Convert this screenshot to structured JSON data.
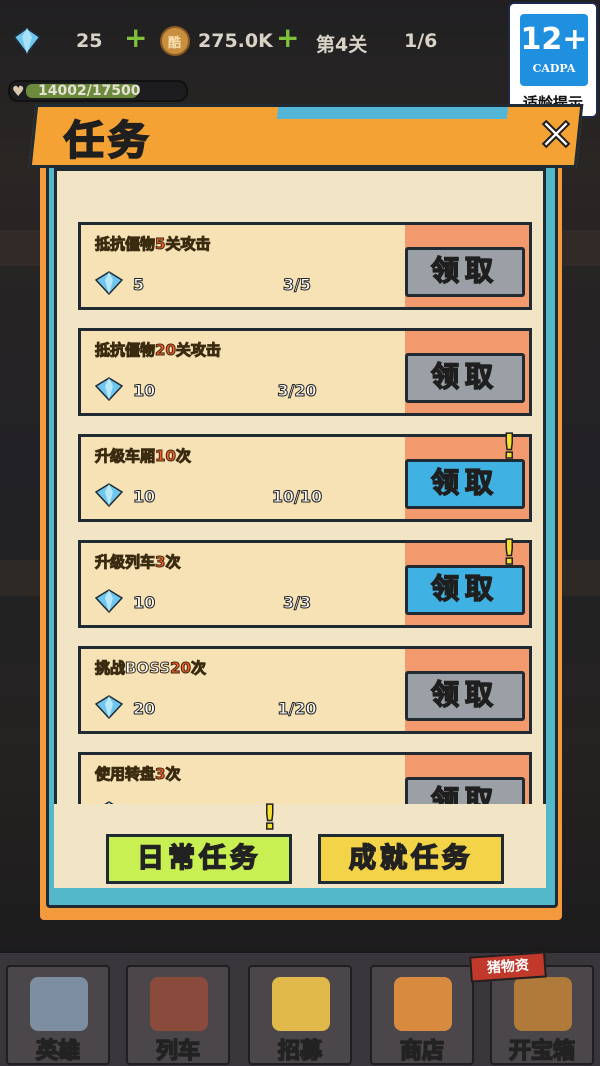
{
  "hud": {
    "gems": "25",
    "coins": "275.0K",
    "stage": "第4关",
    "wave": "1/6",
    "hp": "14002/17500",
    "hp_fraction": 0.8,
    "coin_glyph": "酷"
  },
  "rating": {
    "age": "12+",
    "brand": "CADPA",
    "tip": "适龄提示"
  },
  "dialog": {
    "title": "任务",
    "close": "✕"
  },
  "tasks": [
    {
      "label_pre": "抵抗僵物",
      "highlight": "5",
      "label_post": "关攻击",
      "reward": "5",
      "progress": "3/5",
      "claim": "领取",
      "claimable": false
    },
    {
      "label_pre": "抵抗僵物",
      "highlight": "20",
      "label_post": "关攻击",
      "reward": "10",
      "progress": "3/20",
      "claim": "领取",
      "claimable": false
    },
    {
      "label_pre": "升级车厢",
      "highlight": "10",
      "label_post": "次",
      "reward": "10",
      "progress": "10/10",
      "claim": "领取",
      "claimable": true
    },
    {
      "label_pre": "升级列车",
      "highlight": "3",
      "label_post": "次",
      "reward": "10",
      "progress": "3/3",
      "claim": "领取",
      "claimable": true
    },
    {
      "label_pre": "挑战BOSS",
      "highlight": "20",
      "label_post": "次",
      "reward": "20",
      "progress": "1/20",
      "claim": "领取",
      "claimable": false
    },
    {
      "label_pre": "使用转盘",
      "highlight": "3",
      "label_post": "次",
      "reward": "",
      "progress": "",
      "claim": "领取",
      "claimable": false
    }
  ],
  "tabs": {
    "daily": "日常任务",
    "achievement": "成就任务",
    "alert": "!"
  },
  "nav": {
    "items": [
      "英雄",
      "列车",
      "招募",
      "商店",
      "开宝箱"
    ],
    "shop_tag": "猪物资"
  },
  "colors": {
    "panel_border": "#53b8c9",
    "title_bar": "#f5a235",
    "claim_active": "#3fb2e3",
    "claim_inactive": "#9aa0a5",
    "highlight_text": "#ff5a2a"
  }
}
